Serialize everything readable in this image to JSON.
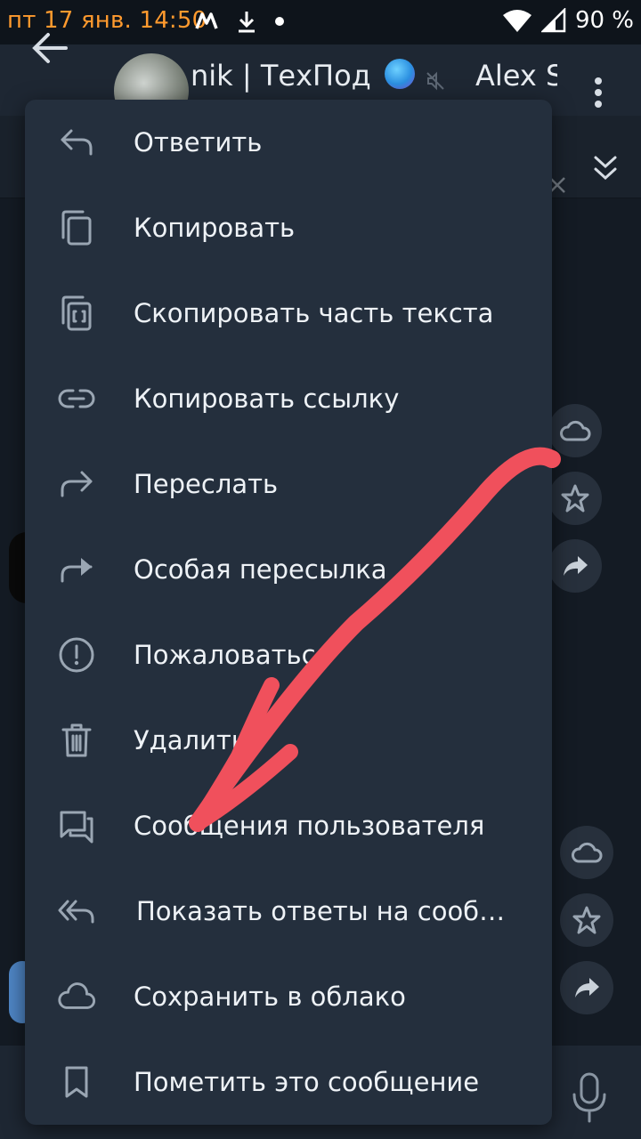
{
  "status_bar": {
    "time": "пт 17 янв. 14:50",
    "battery": "90 %"
  },
  "chat_header": {
    "title": "nik | ТехПод",
    "participant": "Alex S"
  },
  "context_menu": {
    "items": [
      {
        "label": "Ответить",
        "icon": "reply-icon"
      },
      {
        "label": "Копировать",
        "icon": "copy-icon"
      },
      {
        "label": "Скопировать часть текста",
        "icon": "copy-part-icon"
      },
      {
        "label": "Копировать ссылку",
        "icon": "link-icon"
      },
      {
        "label": "Переслать",
        "icon": "forward-icon"
      },
      {
        "label": "Особая пересылка",
        "icon": "forward-special-icon"
      },
      {
        "label": "Пожаловаться",
        "icon": "report-icon"
      },
      {
        "label": "Удалить",
        "icon": "delete-icon"
      },
      {
        "label": "Сообщения пользователя",
        "icon": "user-messages-icon"
      },
      {
        "label": "Показать ответы на сообщ...",
        "icon": "replies-icon"
      },
      {
        "label": "Сохранить в облако",
        "icon": "cloud-icon"
      },
      {
        "label": "Пометить это сообщение",
        "icon": "bookmark-icon"
      }
    ]
  },
  "colors": {
    "accent_clock": "#ff9a2e",
    "menu_bg": "#242f3d",
    "annotation_arrow": "#f0505c"
  }
}
